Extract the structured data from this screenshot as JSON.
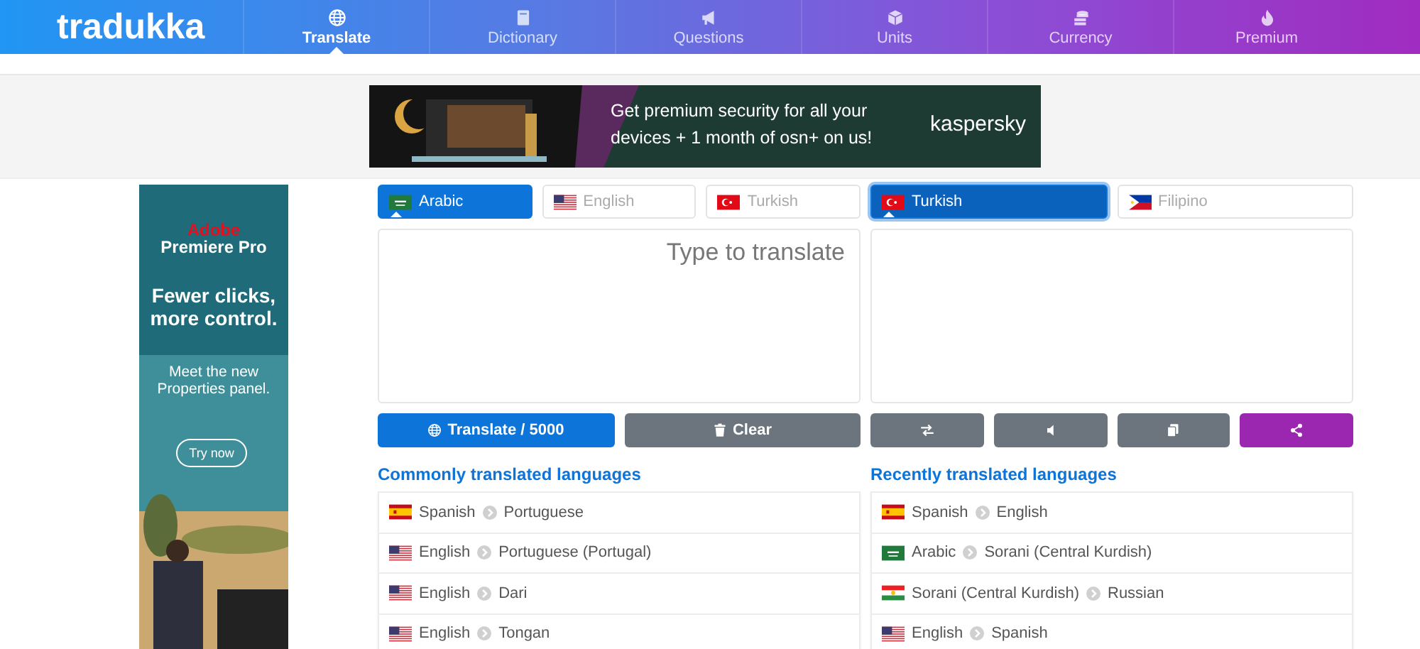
{
  "header": {
    "logo": "tradukka",
    "nav": [
      {
        "label": "Translate",
        "selected": true
      },
      {
        "label": "Dictionary",
        "selected": false
      },
      {
        "label": "Questions",
        "selected": false
      },
      {
        "label": "Units",
        "selected": false
      },
      {
        "label": "Currency",
        "selected": false
      },
      {
        "label": "Premium",
        "selected": false
      }
    ]
  },
  "banner_ad": {
    "headline": "Get premium security for all your devices + 1 month of osn+ on us!",
    "brand": "kaspersky"
  },
  "side_ad": {
    "brand": "Adobe",
    "product": "Premiere Pro",
    "headline": "Fewer clicks, more control.",
    "body": "Meet the new Properties panel.",
    "button": "Try now"
  },
  "source_tabs": [
    {
      "label": "Arabic",
      "kind": "sa",
      "selected": true
    },
    {
      "label": "English",
      "kind": "us",
      "selected": false
    },
    {
      "label": "Turkish",
      "kind": "tr",
      "selected": false
    }
  ],
  "target_tabs": [
    {
      "label": "Turkish",
      "kind": "tr",
      "selected": true
    },
    {
      "label": "Filipino",
      "kind": "ph",
      "selected": false
    }
  ],
  "source_text": {
    "placeholder": "Type to translate"
  },
  "buttons": [
    {
      "kind": "translate",
      "label": "Translate / 5000"
    },
    {
      "kind": "clear",
      "label": "Clear"
    },
    {
      "kind": "swap"
    },
    {
      "kind": "speak"
    },
    {
      "kind": "copy"
    },
    {
      "kind": "share"
    }
  ],
  "common": {
    "title": "Commonly translated languages",
    "pairs": [
      {
        "from": "Spanish",
        "to": "Portuguese",
        "kind": "es"
      },
      {
        "from": "English",
        "to": "Portuguese (Portugal)",
        "kind": "us"
      },
      {
        "from": "English",
        "to": "Dari",
        "kind": "us"
      },
      {
        "from": "English",
        "to": "Tongan",
        "kind": "us"
      }
    ]
  },
  "recent": {
    "title": "Recently translated languages",
    "pairs": [
      {
        "from": "Spanish",
        "to": "English",
        "kind": "es"
      },
      {
        "from": "Arabic",
        "to": "Sorani (Central Kurdish)",
        "kind": "sa"
      },
      {
        "from": "Sorani (Central Kurdish)",
        "to": "Russian",
        "kind": "ku"
      },
      {
        "from": "English",
        "to": "Spanish",
        "kind": "us"
      }
    ]
  }
}
